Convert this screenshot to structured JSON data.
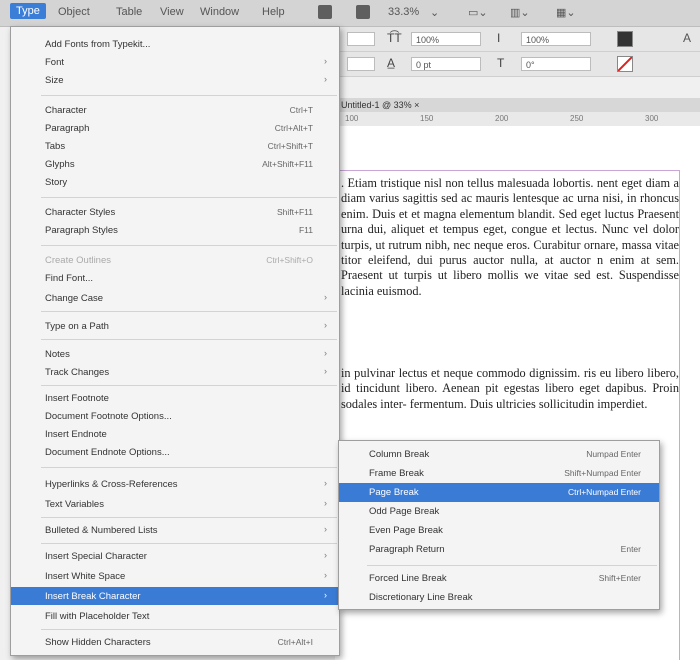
{
  "menubar": {
    "items": [
      "Type",
      "Object",
      "Table",
      "View",
      "Window",
      "Help"
    ],
    "zoom": "33.3%"
  },
  "control": {
    "row1": {
      "font_size": "100%",
      "scale": "100%"
    },
    "row2": {
      "leading": "0 pt",
      "skew": "0°"
    },
    "misc_letter": "A"
  },
  "document": {
    "tab": "Untitled-1 @ 33% ×",
    "ruler": [
      "100",
      "150",
      "200",
      "250",
      "300"
    ],
    "paragraph1": ". Etiam tristique nisl non tellus malesuada lobortis. nent eget diam a diam varius sagittis sed ac mauris lentesque ac urna nisi, in rhoncus enim. Duis et et magna elementum blandit. Sed eget luctus Praesent urna dui, aliquet et tempus eget, congue et lectus. Nunc vel dolor turpis, ut rutrum nibh, nec neque eros. Curabitur ornare, massa vitae titor eleifend, dui purus auctor nulla, at auctor n enim at sem. Praesent ut turpis ut libero mollis we vitae sed est. Suspendisse lacinia euismod.",
    "paragraph2": "in pulvinar lectus et neque commodo dignissim. ris eu libero libero, id tincidunt libero. Aenean pit egestas libero eget dapibus. Proin sodales inter- fermentum. Duis ultricies sollicitudin imperdiet."
  },
  "type_menu": {
    "items": [
      {
        "label": "Add Fonts from Typekit...",
        "shortcut": "",
        "submenu": false
      },
      {
        "label": "Font",
        "shortcut": "",
        "submenu": true
      },
      {
        "label": "Size",
        "shortcut": "",
        "submenu": true
      },
      {
        "label": "Character",
        "shortcut": "Ctrl+T",
        "submenu": false
      },
      {
        "label": "Paragraph",
        "shortcut": "Ctrl+Alt+T",
        "submenu": false
      },
      {
        "label": "Tabs",
        "shortcut": "Ctrl+Shift+T",
        "submenu": false
      },
      {
        "label": "Glyphs",
        "shortcut": "Alt+Shift+F11",
        "submenu": false
      },
      {
        "label": "Story",
        "shortcut": "",
        "submenu": false
      },
      {
        "label": "Character Styles",
        "shortcut": "Shift+F11",
        "submenu": false
      },
      {
        "label": "Paragraph Styles",
        "shortcut": "F11",
        "submenu": false
      },
      {
        "label": "Create Outlines",
        "shortcut": "Ctrl+Shift+O",
        "submenu": false,
        "disabled": true
      },
      {
        "label": "Find Font...",
        "shortcut": "",
        "submenu": false
      },
      {
        "label": "Change Case",
        "shortcut": "",
        "submenu": true
      },
      {
        "label": "Type on a Path",
        "shortcut": "",
        "submenu": true
      },
      {
        "label": "Notes",
        "shortcut": "",
        "submenu": true
      },
      {
        "label": "Track Changes",
        "shortcut": "",
        "submenu": true
      },
      {
        "label": "Insert Footnote",
        "shortcut": "",
        "submenu": false
      },
      {
        "label": "Document Footnote Options...",
        "shortcut": "",
        "submenu": false
      },
      {
        "label": "Insert Endnote",
        "shortcut": "",
        "submenu": false
      },
      {
        "label": "Document Endnote Options...",
        "shortcut": "",
        "submenu": false
      },
      {
        "label": "Hyperlinks & Cross-References",
        "shortcut": "",
        "submenu": true
      },
      {
        "label": "Text Variables",
        "shortcut": "",
        "submenu": true
      },
      {
        "label": "Bulleted & Numbered Lists",
        "shortcut": "",
        "submenu": true
      },
      {
        "label": "Insert Special Character",
        "shortcut": "",
        "submenu": true
      },
      {
        "label": "Insert White Space",
        "shortcut": "",
        "submenu": true
      },
      {
        "label": "Insert Break Character",
        "shortcut": "",
        "submenu": true,
        "highlighted": true
      },
      {
        "label": "Fill with Placeholder Text",
        "shortcut": "",
        "submenu": false
      },
      {
        "label": "Show Hidden Characters",
        "shortcut": "Ctrl+Alt+I",
        "submenu": false
      }
    ]
  },
  "break_submenu": {
    "items": [
      {
        "label": "Column Break",
        "shortcut": "Numpad Enter"
      },
      {
        "label": "Frame Break",
        "shortcut": "Shift+Numpad Enter"
      },
      {
        "label": "Page Break",
        "shortcut": "Ctrl+Numpad Enter",
        "highlighted": true
      },
      {
        "label": "Odd Page Break",
        "shortcut": ""
      },
      {
        "label": "Even Page Break",
        "shortcut": ""
      },
      {
        "label": "Paragraph Return",
        "shortcut": "Enter"
      },
      {
        "label": "Forced Line Break",
        "shortcut": "Shift+Enter"
      },
      {
        "label": "Discretionary Line Break",
        "shortcut": ""
      }
    ]
  }
}
